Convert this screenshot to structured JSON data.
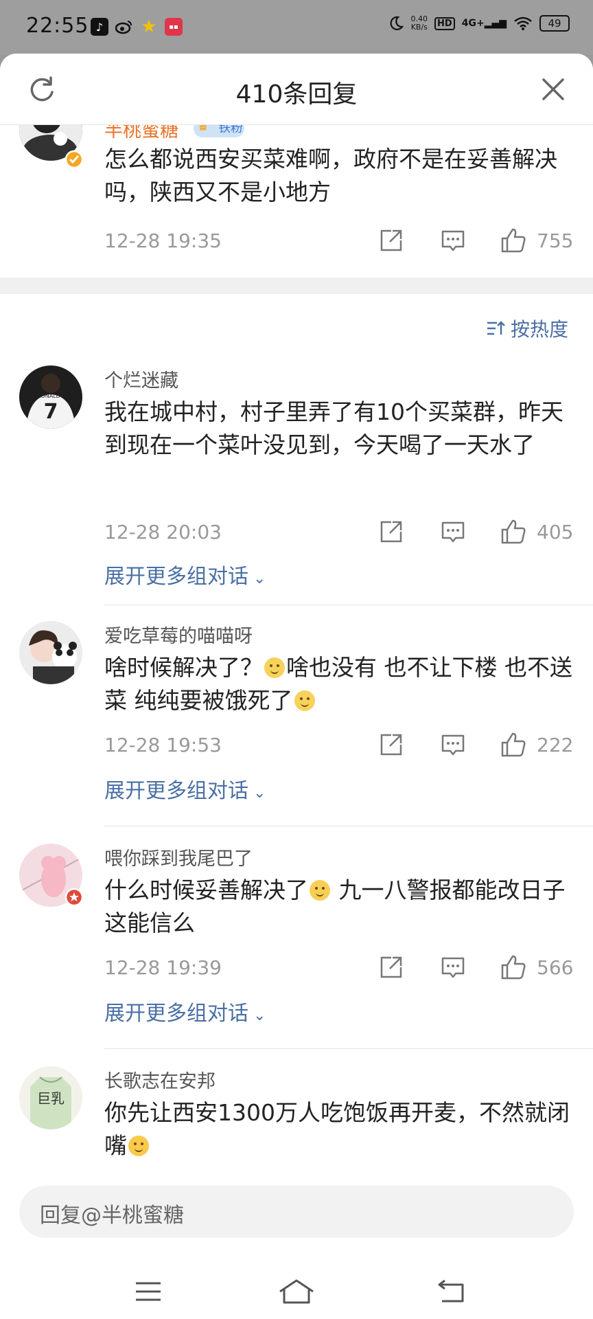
{
  "status_bar": {
    "time": "22:55",
    "net_speed_value": "0.40",
    "net_speed_unit": "KB/s",
    "hd": "HD",
    "network": "4G+",
    "battery": "49"
  },
  "sheet": {
    "title": "410条回复"
  },
  "top_comment": {
    "username": "半桃蜜糖",
    "badge": "铁粉",
    "text": "怎么都说西安买菜难啊，政府不是在妥善解决吗，陕西又不是小地方",
    "time": "12-28 19:35",
    "likes": "755"
  },
  "sort": {
    "label": "按热度"
  },
  "comments": [
    {
      "username": "个烂迷藏",
      "text": "我在城中村，村子里弄了有10个买菜群，昨天到现在一个菜叶没见到，今天喝了一天水了",
      "time": "12-28 20:03",
      "likes": "405",
      "expand": "展开更多组对话"
    },
    {
      "username": "爱吃草莓的喵喵呀",
      "text_parts": [
        "啥时候解决了？",
        "啥也没有 也不让下楼 也不送菜 纯纯要被饿死了"
      ],
      "time": "12-28 19:53",
      "likes": "222",
      "expand": "展开更多组对话"
    },
    {
      "username": "喂你踩到我尾巴了",
      "text_parts": [
        "什么时候妥善解决了",
        " 九一八警报都能改日子 这能信么"
      ],
      "time": "12-28 19:39",
      "likes": "566",
      "expand": "展开更多组对话"
    },
    {
      "username": "长歌志在安邦",
      "text": "你先让西安1300万人吃饱饭再开麦，不然就闭嘴"
    }
  ],
  "avatar_text": {
    "jersey": "7",
    "jersey_name": "RONALDO",
    "shirt": "巨乳"
  },
  "reply_bar": {
    "placeholder": "回复@半桃蜜糖"
  },
  "colors": {
    "link": "#4a6fa5",
    "meta": "#999999",
    "verified": "#f5a623"
  }
}
